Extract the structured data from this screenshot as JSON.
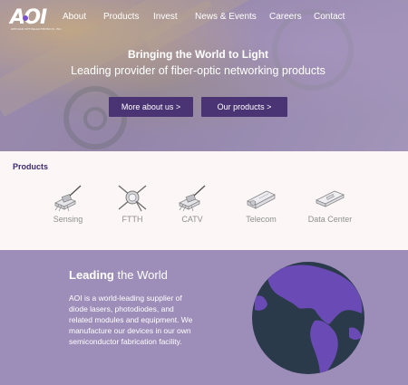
{
  "logo": {
    "text": "AOI",
    "subtext": "APPLIED OPTOELECTRONICS, INC."
  },
  "nav": [
    {
      "label": "About"
    },
    {
      "label": "Products"
    },
    {
      "label": "Invest"
    },
    {
      "label": "News & Events"
    },
    {
      "label": "Careers"
    },
    {
      "label": "Contact"
    }
  ],
  "hero": {
    "title": "Bringing the World to Light",
    "subtitle": "Leading provider of fiber-optic networking products",
    "buttons": [
      {
        "label": "More about us >"
      },
      {
        "label": "Our products >"
      }
    ]
  },
  "products": {
    "heading": "Products",
    "items": [
      {
        "label": "Sensing",
        "icon": "laser-pigtail-icon"
      },
      {
        "label": "FTTH",
        "icon": "to-can-laser-icon"
      },
      {
        "label": "CATV",
        "icon": "laser-pigtail-icon"
      },
      {
        "label": "Telecom",
        "icon": "sfp-transceiver-icon"
      },
      {
        "label": "Data Center",
        "icon": "transceiver-module-icon"
      }
    ]
  },
  "world": {
    "title_bold": "Leading",
    "title_rest": " the World",
    "body": "AOI is a world-leading supplier of diode lasers, photodiodes, and related modules and equipment. We manufacture our devices in our own semiconductor fabrication facility."
  },
  "colors": {
    "button_bg": "#4b3474",
    "products_bg": "#fdf6f6",
    "heading": "#3d2a70",
    "world_bg": "#9d8db9",
    "globe_ocean": "#2b3a4a",
    "globe_land": "#6a4bb6"
  }
}
